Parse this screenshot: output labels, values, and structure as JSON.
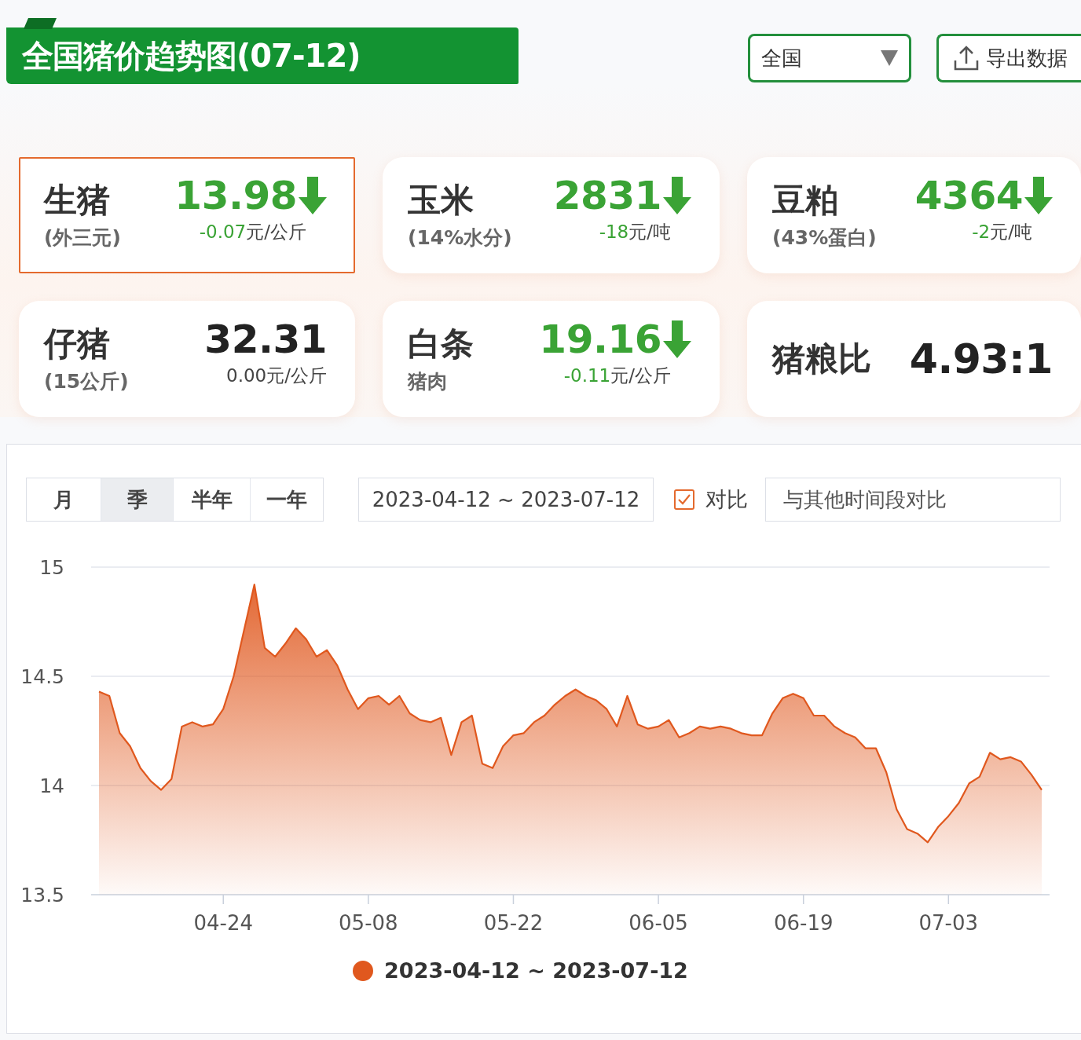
{
  "header": {
    "title": "全国猪价趋势图(07-12)",
    "region_select": {
      "value": "全国"
    },
    "export_button": "导出数据"
  },
  "cards": [
    {
      "kind": "price",
      "name": "生猪",
      "sub": "(外三元)",
      "value": "13.98",
      "falling": true,
      "change": "-0.07",
      "unit": "元/公斤",
      "selected": true
    },
    {
      "kind": "price",
      "name": "玉米",
      "sub": "(14%水分)",
      "value": "2831",
      "falling": true,
      "change": "-18",
      "unit": "元/吨",
      "selected": false
    },
    {
      "kind": "price",
      "name": "豆粕",
      "sub": "(43%蛋白)",
      "value": "4364",
      "falling": true,
      "change": "-2",
      "unit": "元/吨",
      "selected": false
    },
    {
      "kind": "price",
      "name": "仔猪",
      "sub": "(15公斤)",
      "value": "32.31",
      "falling": false,
      "change": "0.00",
      "unit": "元/公斤",
      "selected": false
    },
    {
      "kind": "price",
      "name": "白条",
      "sub": "猪肉",
      "value": "19.16",
      "falling": true,
      "change": "-0.11",
      "unit": "元/公斤",
      "selected": false
    },
    {
      "kind": "ratio",
      "name": "猪粮比",
      "value": "4.93:1",
      "selected": false
    }
  ],
  "chart_panel": {
    "period_tabs": [
      {
        "label": "月",
        "selected": false
      },
      {
        "label": "季",
        "selected": true
      },
      {
        "label": "半年",
        "selected": false
      },
      {
        "label": "一年",
        "selected": false
      }
    ],
    "date_range": "2023-04-12 ~ 2023-07-12",
    "compare": {
      "label": "对比",
      "checked": true
    },
    "compare_input": {
      "placeholder": "与其他时间段对比"
    },
    "chart_data": {
      "type": "area",
      "categories": [
        null,
        null,
        null,
        null,
        null,
        null,
        null,
        null,
        null,
        null,
        null,
        null,
        "04-24",
        null,
        null,
        null,
        null,
        null,
        null,
        null,
        null,
        null,
        null,
        null,
        null,
        null,
        "05-08",
        null,
        null,
        null,
        null,
        null,
        null,
        null,
        null,
        null,
        null,
        null,
        null,
        null,
        "05-22",
        null,
        null,
        null,
        null,
        null,
        null,
        null,
        null,
        null,
        null,
        null,
        null,
        null,
        "06-05",
        null,
        null,
        null,
        null,
        null,
        null,
        null,
        null,
        null,
        null,
        null,
        null,
        null,
        "06-19",
        null,
        null,
        null,
        null,
        null,
        null,
        null,
        null,
        null,
        null,
        null,
        null,
        null,
        "07-03",
        null,
        null,
        null,
        null,
        null,
        null,
        null,
        null,
        null
      ],
      "ylim": [
        13.5,
        15
      ],
      "yticks": [
        13.5,
        14,
        14.5,
        15
      ],
      "series": [
        {
          "name": "2023-04-12 ~ 2023-07-12",
          "color": "#e0581e",
          "values": [
            14.43,
            14.41,
            14.24,
            14.18,
            14.08,
            14.02,
            13.98,
            14.03,
            14.27,
            14.29,
            14.27,
            14.28,
            14.35,
            14.5,
            14.71,
            14.92,
            14.63,
            14.59,
            14.65,
            14.72,
            14.67,
            14.59,
            14.62,
            14.55,
            14.44,
            14.35,
            14.4,
            14.41,
            14.37,
            14.41,
            14.33,
            14.3,
            14.29,
            14.31,
            14.14,
            14.29,
            14.32,
            14.1,
            14.08,
            14.18,
            14.23,
            14.24,
            14.29,
            14.32,
            14.37,
            14.41,
            14.44,
            14.41,
            14.39,
            14.35,
            14.27,
            14.41,
            14.28,
            14.26,
            14.27,
            14.3,
            14.22,
            14.24,
            14.27,
            14.26,
            14.27,
            14.26,
            14.24,
            14.23,
            14.23,
            14.33,
            14.4,
            14.42,
            14.4,
            14.32,
            14.32,
            14.27,
            14.24,
            14.22,
            14.17,
            14.17,
            14.06,
            13.89,
            13.8,
            13.78,
            13.74,
            13.81,
            13.86,
            13.92,
            14.01,
            14.04,
            14.15,
            14.12,
            14.13,
            14.11,
            14.05,
            13.98
          ]
        }
      ]
    }
  }
}
